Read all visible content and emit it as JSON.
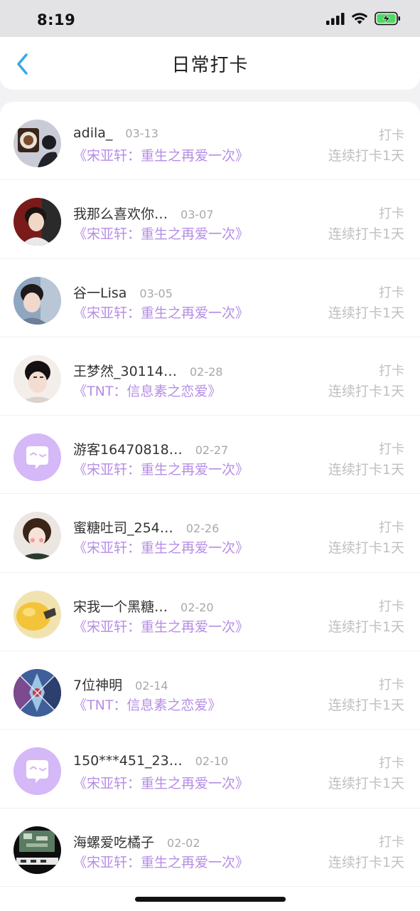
{
  "status_bar": {
    "time": "8:19"
  },
  "header": {
    "title": "日常打卡"
  },
  "items": [
    {
      "name": "adila_",
      "date": "03-13",
      "book": "《宋亚轩：重生之再爱一次》",
      "action": "打卡",
      "streak": "连续打卡1天",
      "avatar": "photo"
    },
    {
      "name": "我那么喜欢你…",
      "date": "03-07",
      "book": "《宋亚轩：重生之再爱一次》",
      "action": "打卡",
      "streak": "连续打卡1天",
      "avatar": "photo"
    },
    {
      "name": "谷一Lisa",
      "date": "03-05",
      "book": "《宋亚轩：重生之再爱一次》",
      "action": "打卡",
      "streak": "连续打卡1天",
      "avatar": "photo"
    },
    {
      "name": "王梦然_30114…",
      "date": "02-28",
      "book": "《TNT：信息素之恋爱》",
      "action": "打卡",
      "streak": "连续打卡1天",
      "avatar": "photo"
    },
    {
      "name": "游客16470818…",
      "date": "02-27",
      "book": "《宋亚轩：重生之再爱一次》",
      "action": "打卡",
      "streak": "连续打卡1天",
      "avatar": "default"
    },
    {
      "name": "蜜糖吐司_254…",
      "date": "02-26",
      "book": "《宋亚轩：重生之再爱一次》",
      "action": "打卡",
      "streak": "连续打卡1天",
      "avatar": "photo"
    },
    {
      "name": "宋我一个黑糖…",
      "date": "02-20",
      "book": "《宋亚轩：重生之再爱一次》",
      "action": "打卡",
      "streak": "连续打卡1天",
      "avatar": "photo"
    },
    {
      "name": "7位神明",
      "date": "02-14",
      "book": "《TNT：信息素之恋爱》",
      "action": "打卡",
      "streak": "连续打卡1天",
      "avatar": "photo"
    },
    {
      "name": "150***451_23…",
      "date": "02-10",
      "book": "《宋亚轩：重生之再爱一次》",
      "action": "打卡",
      "streak": "连续打卡1天",
      "avatar": "default"
    },
    {
      "name": "海螺爱吃橘子",
      "date": "02-02",
      "book": "《宋亚轩：重生之再爱一次》",
      "action": "打卡",
      "streak": "连续打卡1天",
      "avatar": "photo"
    }
  ],
  "colors": {
    "accent": "#3aa6e8",
    "book_title": "#b68de6",
    "default_avatar_bg": "#d5b8f7",
    "muted": "#c0c0c2"
  },
  "icons": {
    "back": "chevron-left-icon",
    "signal": "cellular-signal-icon",
    "wifi": "wifi-icon",
    "battery": "battery-charging-icon",
    "default_avatar": "chat-bubble-face-icon"
  }
}
